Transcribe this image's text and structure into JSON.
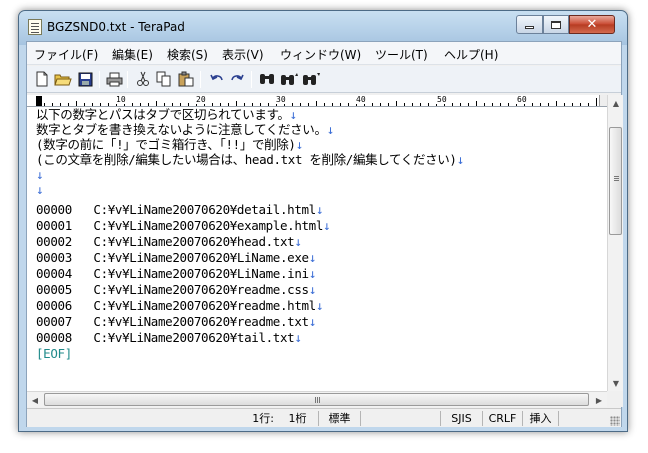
{
  "window": {
    "title": "BGZSND0.txt - TeraPad",
    "close_glyph": "✕"
  },
  "menu": {
    "items": [
      {
        "label": "ファイル(F)"
      },
      {
        "label": "編集(E)"
      },
      {
        "label": "検索(S)"
      },
      {
        "label": "表示(V)"
      },
      {
        "label": "ウィンドウ(W)"
      },
      {
        "label": "ツール(T)"
      },
      {
        "label": "ヘルプ(H)"
      }
    ]
  },
  "toolbar": {
    "icons": [
      "new-file-icon",
      "open-folder-icon",
      "save-icon",
      "print-icon",
      "cut-icon",
      "copy-icon",
      "paste-icon",
      "undo-icon",
      "redo-icon",
      "find-icon",
      "find-previous-icon",
      "find-next-icon"
    ]
  },
  "ruler": {
    "labels": [
      "10",
      "20",
      "30",
      "40",
      "50",
      "60"
    ]
  },
  "editor": {
    "newline_mark": "↓",
    "lines": [
      {
        "text": "以下の数字とパスはタブで区切られています。",
        "nl": true
      },
      {
        "text": "数字とタブを書き換えないように注意してください。",
        "nl": true
      },
      {
        "text": "(数字の前に「!」でゴミ箱行き、「!!」で削除)",
        "nl": true
      },
      {
        "text": "(この文章を削除/編集したい場合は、head.txt を削除/編集してください)",
        "nl": true
      },
      {
        "text": "",
        "nl": true
      },
      {
        "text": "",
        "nl": true
      },
      {
        "text": "00000   C:¥v¥LiName20070620¥detail.html",
        "nl": true
      },
      {
        "text": "00001   C:¥v¥LiName20070620¥example.html",
        "nl": true
      },
      {
        "text": "00002   C:¥v¥LiName20070620¥head.txt",
        "nl": true
      },
      {
        "text": "00003   C:¥v¥LiName20070620¥LiName.exe",
        "nl": true
      },
      {
        "text": "00004   C:¥v¥LiName20070620¥LiName.ini",
        "nl": true
      },
      {
        "text": "00005   C:¥v¥LiName20070620¥readme.css",
        "nl": true
      },
      {
        "text": "00006   C:¥v¥LiName20070620¥readme.html",
        "nl": true
      },
      {
        "text": "00007   C:¥v¥LiName20070620¥readme.txt",
        "nl": true
      },
      {
        "text": "00008   C:¥v¥LiName20070620¥tail.txt",
        "nl": true
      }
    ],
    "eof_marker": "[EOF]"
  },
  "status": {
    "line": "1行:",
    "column": "1桁",
    "mode": "標準",
    "encoding": "SJIS",
    "line_ending": "CRLF",
    "insert_mode": "挿入"
  },
  "colors": {
    "newline_mark": "#3d6fd6",
    "eof_marker": "#1f8a8a"
  }
}
